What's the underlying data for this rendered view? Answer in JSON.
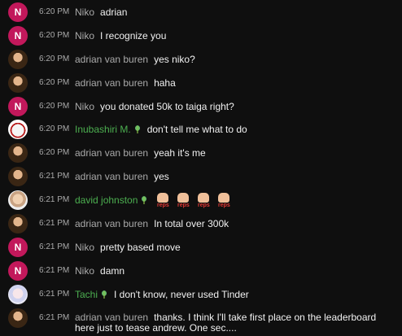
{
  "messages": [
    {
      "avatar": "N",
      "avatar_kind": "letter",
      "time": "6:20 PM",
      "author": "Niko",
      "verified": false,
      "text": "adrian"
    },
    {
      "avatar": "N",
      "avatar_kind": "letter",
      "time": "6:20 PM",
      "author": "Niko",
      "verified": false,
      "text": "I recognize you"
    },
    {
      "avatar": "",
      "avatar_kind": "pic-adrian",
      "time": "6:20 PM",
      "author": "adrian van buren",
      "verified": false,
      "text": "yes niko?"
    },
    {
      "avatar": "",
      "avatar_kind": "pic-adrian",
      "time": "6:20 PM",
      "author": "adrian van buren",
      "verified": false,
      "text": "haha"
    },
    {
      "avatar": "N",
      "avatar_kind": "letter",
      "time": "6:20 PM",
      "author": "Niko",
      "verified": false,
      "text": "you donated 50k to taiga right?"
    },
    {
      "avatar": "",
      "avatar_kind": "pic-inu",
      "time": "6:20 PM",
      "author": "Inubashiri M.",
      "verified": true,
      "text": "don't tell me what to do"
    },
    {
      "avatar": "",
      "avatar_kind": "pic-adrian",
      "time": "6:20 PM",
      "author": "adrian van buren",
      "verified": false,
      "text": "yeah it's me"
    },
    {
      "avatar": "",
      "avatar_kind": "pic-adrian",
      "time": "6:21 PM",
      "author": "adrian van buren",
      "verified": false,
      "text": "yes"
    },
    {
      "avatar": "",
      "avatar_kind": "pic-david",
      "time": "6:21 PM",
      "author": "david johnston",
      "verified": true,
      "text": "",
      "emotes": [
        "reps",
        "reps",
        "reps",
        "reps"
      ]
    },
    {
      "avatar": "",
      "avatar_kind": "pic-adrian",
      "time": "6:21 PM",
      "author": "adrian van buren",
      "verified": false,
      "text": "In total over 300k"
    },
    {
      "avatar": "N",
      "avatar_kind": "letter",
      "time": "6:21 PM",
      "author": "Niko",
      "verified": false,
      "text": "pretty based move"
    },
    {
      "avatar": "N",
      "avatar_kind": "letter",
      "time": "6:21 PM",
      "author": "Niko",
      "verified": false,
      "text": "damn"
    },
    {
      "avatar": "",
      "avatar_kind": "pic-tachi",
      "time": "6:21 PM",
      "author": "Tachi",
      "verified": true,
      "text": "I don't know, never used Tinder"
    },
    {
      "avatar": "",
      "avatar_kind": "pic-adrian",
      "time": "6:21 PM",
      "author": "adrian van buren",
      "verified": false,
      "text": "thanks. I think I'll take first place on the leaderboard here just to tease andrew. One sec....",
      "multiline": true
    }
  ],
  "colors": {
    "background": "#0f0f0f",
    "author": "#aaaaaa",
    "member_author": "#4caf50",
    "text": "#f1f1f1",
    "letter_avatar": "#c2185b",
    "emote_label": "#e53935"
  },
  "icons": {
    "member_badge": "leaf-badge-icon"
  }
}
